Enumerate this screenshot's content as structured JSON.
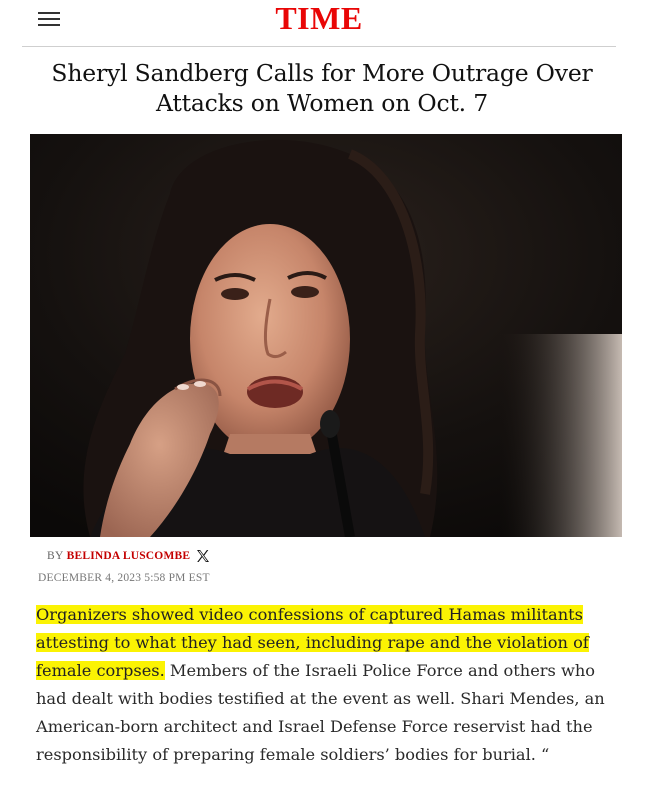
{
  "site": {
    "logo_text": "TIME",
    "brand_color": "#e90606",
    "menu_icon": "hamburger-menu-icon"
  },
  "article": {
    "headline": "Sheryl Sandberg Calls for More Outrage Over Attacks on Women on Oct. 7",
    "byline_prefix": "By",
    "author": "Belinda Luscombe",
    "author_social_icon": "x-twitter-icon",
    "date": "December 4, 2023 5:58 PM EST",
    "highlighted_text": "Organizers showed video confessions of captured Hamas militants attesting to what they had seen, including rape and the violation of female corpses.",
    "body_text": " Members of the Israeli Police Force and others who had dealt with bodies testified at the event as well. Shari Mendes, an American-born architect and Israel Defense Force reservist had the responsibility of preparing female soldiers’ bodies for burial. “",
    "highlight_color": "#fbf303"
  }
}
